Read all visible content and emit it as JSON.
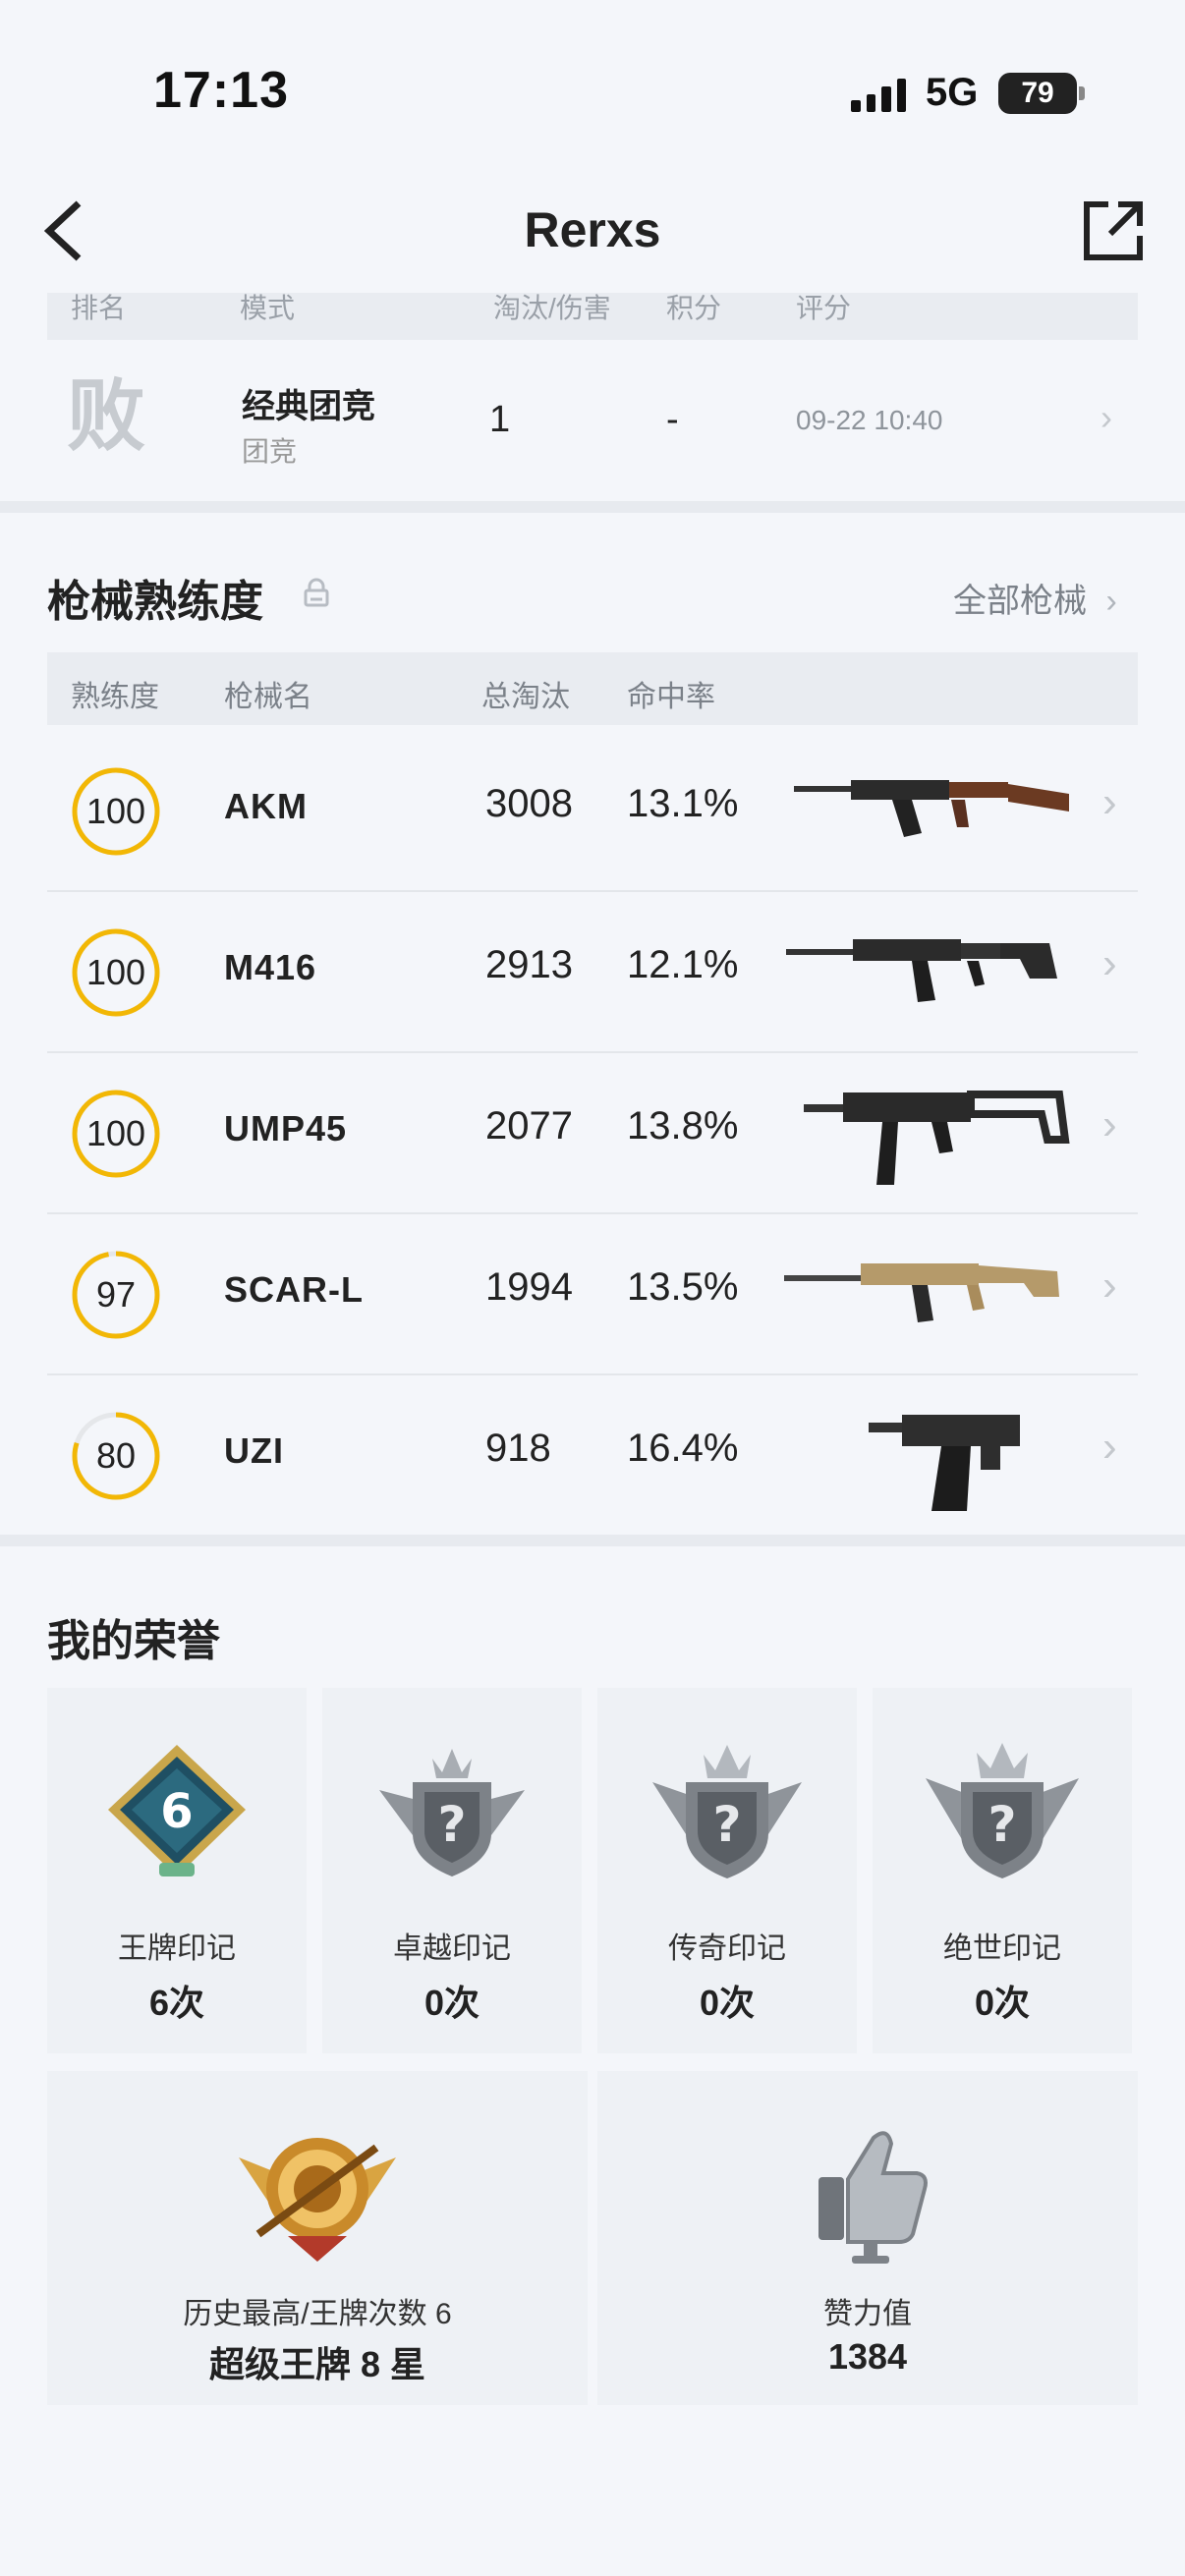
{
  "status_bar": {
    "time": "17:13",
    "network": "5G",
    "battery": "79"
  },
  "header": {
    "title": "Rerxs"
  },
  "match_table": {
    "columns": [
      "排名",
      "模式",
      "淘汰/伤害",
      "积分",
      "评分"
    ],
    "row": {
      "result": "败",
      "mode": "经典团竞",
      "sub_mode": "团竞",
      "kills": "1",
      "score": "-",
      "time": "09-22 10:40"
    }
  },
  "weapons": {
    "title": "枪械熟练度",
    "all_label": "全部枪械",
    "columns": [
      "熟练度",
      "枪械名",
      "总淘汰",
      "命中率"
    ],
    "ring_color": "#f2b705",
    "rows": [
      {
        "level": "100",
        "progress": 1.0,
        "name": "AKM",
        "kills": "3008",
        "accuracy": "13.1%",
        "icon": "rifle-akm"
      },
      {
        "level": "100",
        "progress": 1.0,
        "name": "M416",
        "kills": "2913",
        "accuracy": "12.1%",
        "icon": "rifle-m416"
      },
      {
        "level": "100",
        "progress": 1.0,
        "name": "UMP45",
        "kills": "2077",
        "accuracy": "13.8%",
        "icon": "smg-ump45"
      },
      {
        "level": "97",
        "progress": 0.97,
        "name": "SCAR-L",
        "kills": "1994",
        "accuracy": "13.5%",
        "icon": "rifle-scarl"
      },
      {
        "level": "80",
        "progress": 0.8,
        "name": "UZI",
        "kills": "918",
        "accuracy": "16.4%",
        "icon": "smg-uzi"
      }
    ]
  },
  "honors": {
    "title": "我的荣誉",
    "badges": [
      {
        "label": "王牌印记",
        "count": "6次",
        "icon": "ace-badge-icon",
        "number": "6"
      },
      {
        "label": "卓越印记",
        "count": "0次",
        "icon": "locked-crown-badge-icon",
        "number": "?"
      },
      {
        "label": "传奇印记",
        "count": "0次",
        "icon": "locked-crown-badge-icon",
        "number": "?"
      },
      {
        "label": "绝世印记",
        "count": "0次",
        "icon": "locked-crown-badge-icon",
        "number": "?"
      }
    ],
    "peak": {
      "label": "历史最高/王牌次数 6",
      "value": "超级王牌 8 星",
      "icon": "super-ace-emblem-icon"
    },
    "likes": {
      "label": "赞力值",
      "value": "1384",
      "icon": "thumbs-up-icon"
    }
  }
}
